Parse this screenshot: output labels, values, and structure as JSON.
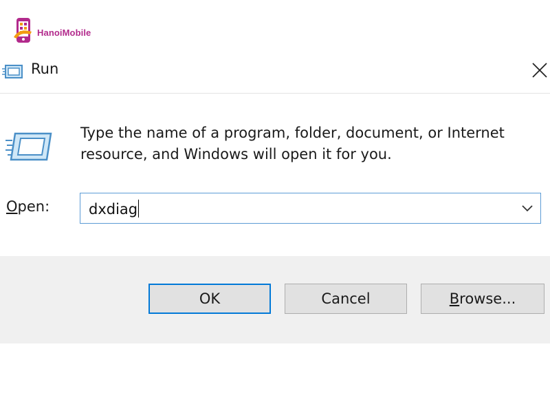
{
  "watermark": {
    "brand": "HanoiMobile"
  },
  "dialog": {
    "title": "Run",
    "description": "Type the name of a program, folder, document, or Internet resource, and Windows will open it for you.",
    "open_label_mnemonic": "O",
    "open_label_rest": "pen:",
    "input_value": "dxdiag",
    "buttons": {
      "ok": "OK",
      "cancel": "Cancel",
      "browse_mnemonic": "B",
      "browse_rest": "rowse..."
    }
  },
  "colors": {
    "accent": "#0078d7",
    "input_border": "#5b9bd5",
    "footer_bg": "#f0f0f0",
    "button_bg": "#e1e1e1",
    "watermark": "#b22a8c"
  },
  "icons": {
    "title": "run-app-icon",
    "content": "run-large-icon",
    "close": "close-icon",
    "dropdown": "chevron-down-icon",
    "watermark": "hanoimobile-logo-icon"
  }
}
